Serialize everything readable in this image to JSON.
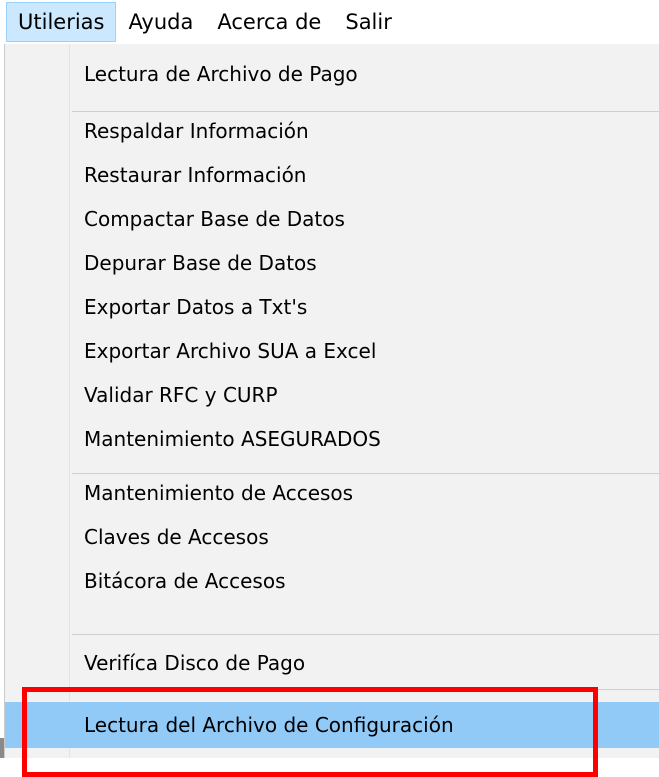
{
  "menubar": {
    "items": [
      {
        "label": "Utilerias",
        "active": true
      },
      {
        "label": "Ayuda",
        "active": false
      },
      {
        "label": "Acerca de",
        "active": false
      },
      {
        "label": "Salir",
        "active": false
      }
    ]
  },
  "dropdown": {
    "items": [
      {
        "label": "Lectura de Archivo de Pago"
      },
      {
        "label": "Respaldar Información"
      },
      {
        "label": "Restaurar Información"
      },
      {
        "label": "Compactar Base de Datos"
      },
      {
        "label": "Depurar Base de Datos"
      },
      {
        "label": "Exportar Datos a Txt's"
      },
      {
        "label": "Exportar Archivo SUA a Excel"
      },
      {
        "label": "Validar RFC y CURP"
      },
      {
        "label": "Mantenimiento ASEGURADOS"
      },
      {
        "label": "Mantenimiento de Accesos"
      },
      {
        "label": "Claves de Accesos"
      },
      {
        "label": "Bitácora de Accesos"
      },
      {
        "label": "Verifíca Disco de Pago"
      },
      {
        "label": "Lectura del Archivo de Configuración",
        "highlighted": true
      }
    ]
  },
  "colors": {
    "highlight": "#91c9f7",
    "menubar_active": "#cce8ff",
    "annotation": "#ff0000"
  }
}
